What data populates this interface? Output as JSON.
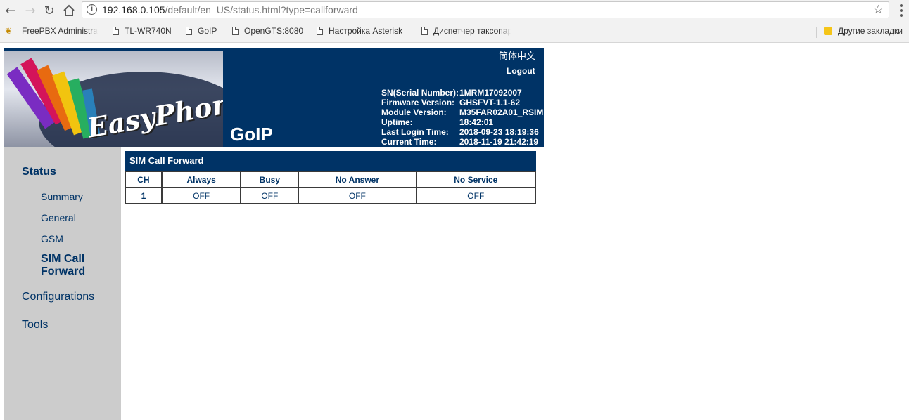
{
  "browser": {
    "url_host": "192.168.0.105",
    "url_path": "/default/en_US/status.html?type=callforward",
    "bookmarks": [
      {
        "label": "FreePBX Administrat",
        "icon": "freepbx-icon"
      },
      {
        "label": "TL-WR740N",
        "icon": "page-icon"
      },
      {
        "label": "GoIP",
        "icon": "page-icon"
      },
      {
        "label": "OpenGTS:8080",
        "icon": "page-icon"
      },
      {
        "label": "Настройка Asterisk",
        "icon": "page-icon"
      },
      {
        "label": "Диспетчер таксопар",
        "icon": "page-icon"
      }
    ],
    "other_bookmarks": "Другие закладки"
  },
  "header": {
    "logo_text": "EasyPhone",
    "product": "GoIP",
    "language_link": "简体中文",
    "logout": "Logout",
    "info": [
      {
        "label": "SN(Serial Number):",
        "value": "1MRM17092007"
      },
      {
        "label": "Firmware Version:",
        "value": "GHSFVT-1.1-62"
      },
      {
        "label": "Module Version:",
        "value": "M35FAR02A01_RSIM"
      },
      {
        "label": "Uptime:",
        "value": "18:42:01"
      },
      {
        "label": "Last Login Time:",
        "value": "2018-09-23 18:19:36"
      },
      {
        "label": "Current Time:",
        "value": "2018-11-19 21:42:19"
      }
    ]
  },
  "sidebar": {
    "status": "Status",
    "items": [
      "Summary",
      "General",
      "GSM"
    ],
    "active_line1": "SIM Call",
    "active_line2": "Forward",
    "configurations": "Configurations",
    "tools": "Tools"
  },
  "panel": {
    "title": "SIM Call Forward",
    "columns": [
      "CH",
      "Always",
      "Busy",
      "No Answer",
      "No Service"
    ],
    "rows": [
      [
        "1",
        "OFF",
        "OFF",
        "OFF",
        "OFF"
      ]
    ]
  },
  "colors": {
    "navy": "#003366",
    "sidebar": "#cccccc"
  }
}
